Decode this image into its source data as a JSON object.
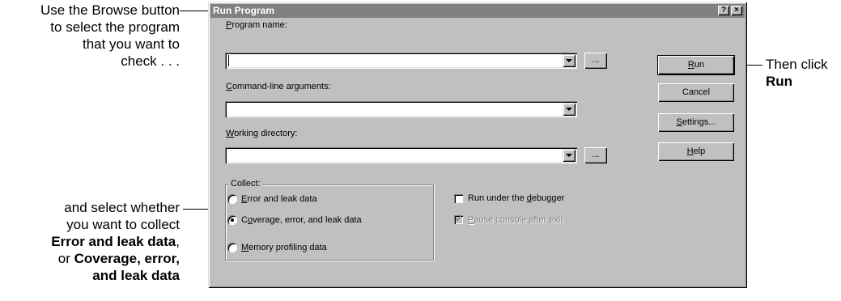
{
  "annotations": {
    "top_left": [
      "Use the Browse button",
      "to select the program",
      "that you want to",
      "check . . ."
    ],
    "bottom_left_plain": [
      "and select whether",
      "you want to collect"
    ],
    "bottom_left_bold1": "Error and leak data",
    "bottom_left_comma": ",",
    "bottom_left_or": "or ",
    "bottom_left_bold2a": "Coverage, error,",
    "bottom_left_bold2b": "and leak data",
    "right_line1": "Then click",
    "right_line2": "Run"
  },
  "dialog": {
    "title": "Run Program",
    "help_btn": "?",
    "close_btn": "×",
    "program_label_u": "P",
    "program_label_rest": "rogram name:",
    "program_value": "",
    "args_label_u": "C",
    "args_label_rest": "ommand-line arguments:",
    "args_value": "",
    "workdir_label_u": "W",
    "workdir_label_rest": "orking directory:",
    "workdir_value": "",
    "browse_label": "...",
    "buttons": {
      "run_u": "R",
      "run_rest": "un",
      "cancel": "Cancel",
      "settings_u": "S",
      "settings_rest": "ettings...",
      "help_u": "H",
      "help_rest": "elp"
    },
    "collect": {
      "title": "Collect:",
      "opt1_u": "E",
      "opt1_rest": "rror and leak data",
      "opt2_pre": "C",
      "opt2_u": "o",
      "opt2_rest": "verage, error, and leak data",
      "opt3_u": "M",
      "opt3_rest": "emory profiling data",
      "selected": 2
    },
    "debugger_pre": "Run under the ",
    "debugger_u": "d",
    "debugger_rest": "ebugger",
    "pause_u": "P",
    "pause_rest": "ause console after exit"
  }
}
